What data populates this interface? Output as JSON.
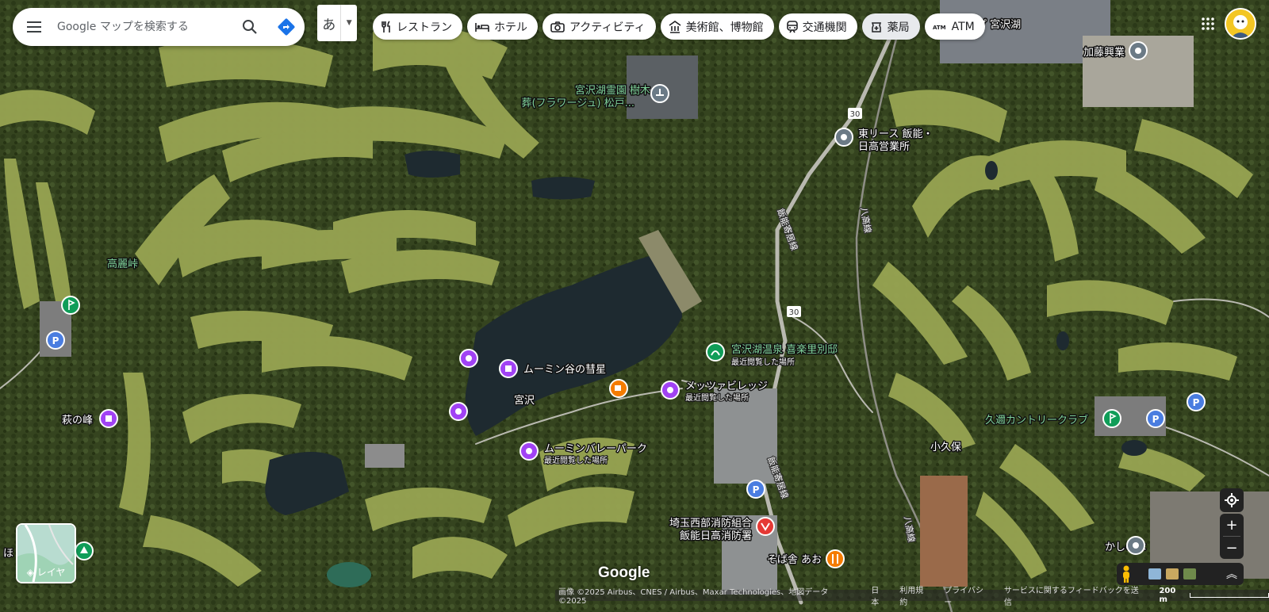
{
  "search": {
    "placeholder": "Google マップを検索する"
  },
  "ime": {
    "label": "あ"
  },
  "chips": [
    {
      "label": "レストラン",
      "icon": "fork-knife-icon"
    },
    {
      "label": "ホテル",
      "icon": "bed-icon"
    },
    {
      "label": "アクティビティ",
      "icon": "camera-icon"
    },
    {
      "label": "美術館、博物館",
      "icon": "museum-icon"
    },
    {
      "label": "交通機関",
      "icon": "train-icon"
    },
    {
      "label": "薬局",
      "icon": "pharmacy-icon"
    },
    {
      "label": "ATM",
      "icon": "atm-icon"
    }
  ],
  "places": {
    "miyazawa_cemetery_1": "宮沢湖霊園 樹木",
    "miyazawa_cemetery_2": "葬(フラワージュ) 松戸...",
    "toyo_lease_1": "東リース 飯能・",
    "toyo_lease_2": "日高営業所",
    "kato": "加藤興業",
    "shop_miyazawa": "ョップ 宮沢湖",
    "koraitoge": "高麗峠",
    "moomin_comet": "ムーミン谷の彗星",
    "onsen": "宮沢湖温泉 喜楽里別邸",
    "recent": "最近閲覧した場所",
    "metsa": "メッツァビレッジ",
    "miyazawa": "宮沢",
    "hagi": "萩の峰",
    "moomin_park": "ムーミンバレーパーク",
    "kyukubo": "小久保",
    "kyuusu": "久邇カントリークラブ",
    "fire_1": "埼玉西部消防組合",
    "fire_2": "飯能日高消防署",
    "soba": "そば舎 あお",
    "kashi": "かしの木",
    "road_hanno": "飯能寄居線",
    "route_30": "30",
    "hachiko": "八高線",
    "ho": "ほ"
  },
  "layer": {
    "label": "レイヤ"
  },
  "logo": "Google",
  "footer": {
    "imagery": "画像 ©2025 Airbus、CNES / Airbus、Maxar Technologies、地図データ ©2025",
    "country": "日本",
    "terms": "利用規約",
    "privacy": "プライバシー",
    "feedback": "サービスに関するフィードバックを送信",
    "scale": "200 m"
  },
  "colors": {
    "map_bg": "#3c4a25",
    "fairway": "#9aa656",
    "lake": "#1f2b33",
    "poi_purple": "#a142f4",
    "poi_green": "#0f9d58",
    "poi_orange": "#f57c00",
    "poi_red": "#e53935",
    "poi_gray": "#6b7a86",
    "parking_blue": "#4a7de0",
    "label_green": "#7fd29a"
  }
}
